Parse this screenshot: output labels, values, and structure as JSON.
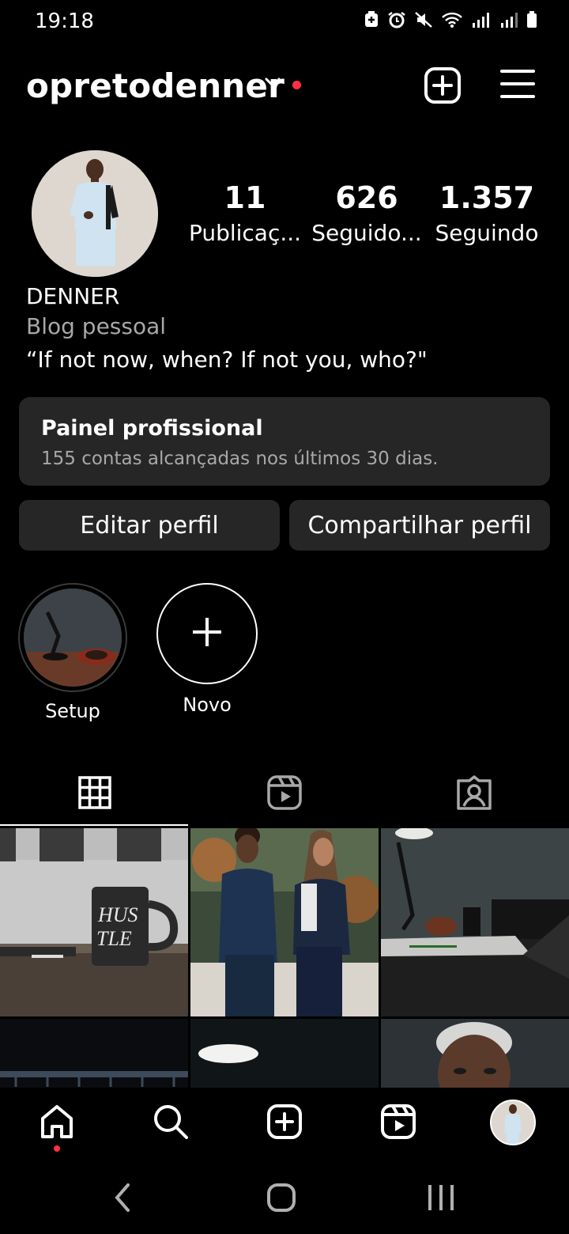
{
  "status_bar": {
    "time": "19:18"
  },
  "header": {
    "username": "opretodenner"
  },
  "profile": {
    "stats": [
      {
        "value": "11",
        "label": "Publicaç..."
      },
      {
        "value": "626",
        "label": "Seguido..."
      },
      {
        "value": "1.357",
        "label": "Seguindo"
      }
    ],
    "name": "DENNER",
    "category": "Blog pessoal",
    "bio": "“If not now, when? If not you, who?\""
  },
  "pro_panel": {
    "title": "Painel profissional",
    "subtitle": "155 contas alcançadas nos últimos 30 dias."
  },
  "actions": {
    "edit": "Editar perfil",
    "share": "Compartilhar perfil"
  },
  "highlights": [
    {
      "label": "Setup"
    }
  ],
  "new_highlight": {
    "label": "Novo"
  },
  "tabs": [
    "grid-icon",
    "reels-icon",
    "tagged-icon"
  ],
  "bottom_nav": [
    "home-icon",
    "search-icon",
    "create-icon",
    "reels-icon",
    "profile-avatar"
  ],
  "colors": {
    "background": "#000000",
    "surface": "#262626",
    "notification": "#ff3040",
    "secondary_text": "#a8a8a8"
  }
}
